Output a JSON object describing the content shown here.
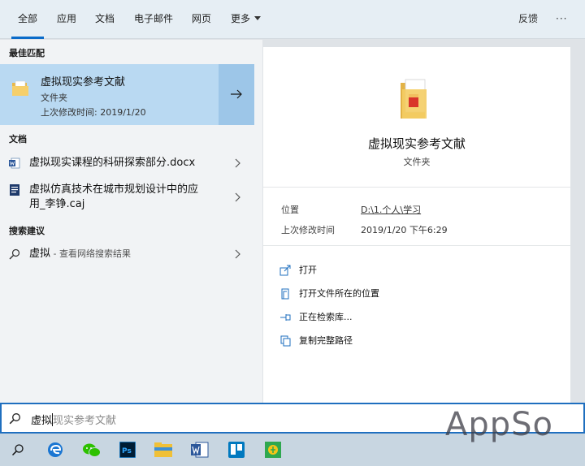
{
  "tabs": [
    {
      "label": "全部",
      "active": true
    },
    {
      "label": "应用"
    },
    {
      "label": "文档"
    },
    {
      "label": "电子邮件"
    },
    {
      "label": "网页"
    },
    {
      "label": "更多"
    }
  ],
  "header_right": {
    "feedback": "反馈",
    "more": "···"
  },
  "left": {
    "best_match_heading": "最佳匹配",
    "best": {
      "title": "虚拟现实参考文献",
      "type": "文件夹",
      "modified": "上次修改时间: 2019/1/20"
    },
    "docs_heading": "文档",
    "docs": [
      {
        "line1": "虚拟现实课程的科研探索部分.docx",
        "line2": ""
      },
      {
        "line1": "虚拟仿真技术在城市规划设计中的应",
        "line2": "用_李铮.caj"
      }
    ],
    "suggest_heading": "搜索建议",
    "suggest": {
      "term": "虚拟",
      "hint": " - 查看网络搜索结果"
    }
  },
  "right": {
    "title": "虚拟现实参考文献",
    "type": "文件夹",
    "location_label": "位置",
    "location_value": "D:\\1.个人\\学习",
    "modified_label": "上次修改时间",
    "modified_value": "2019/1/20 下午6:29",
    "actions": [
      "打开",
      "打开文件所在的位置",
      "正在检索库...",
      "复制完整路径"
    ]
  },
  "search": {
    "typed": "虚拟",
    "ghost": "现实参考文献"
  },
  "taskbar": [
    "search-icon",
    "edge-icon",
    "wechat-icon",
    "photoshop-icon",
    "file-explorer-icon",
    "word-icon",
    "trello-icon",
    "app-icon"
  ],
  "watermark": "AppSo",
  "colors": {
    "accent": "#0a6bc9",
    "selected": "#b9d9f2",
    "selected_arrow": "#9dc6e8"
  }
}
